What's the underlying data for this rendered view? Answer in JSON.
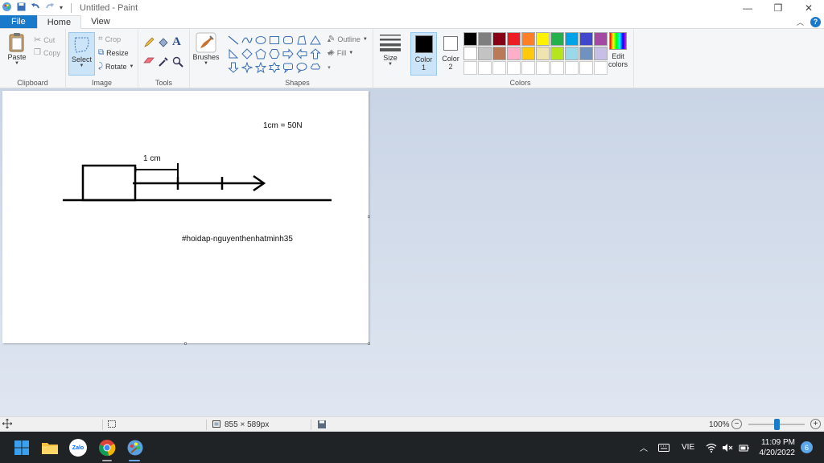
{
  "window": {
    "title": "Untitled - Paint",
    "minimize_glyph": "—",
    "restore_glyph": "❐",
    "close_glyph": "✕"
  },
  "tabs": [
    {
      "label": "File"
    },
    {
      "label": "Home"
    },
    {
      "label": "View"
    }
  ],
  "ribbon": {
    "clipboard": {
      "paste": "Paste",
      "cut": "Cut",
      "copy": "Copy",
      "group": "Clipboard"
    },
    "image": {
      "select": "Select",
      "crop": "Crop",
      "resize": "Resize",
      "rotate": "Rotate",
      "group": "Image"
    },
    "tools": {
      "group": "Tools",
      "text_glyph": "A"
    },
    "brushes": {
      "label": "Brushes"
    },
    "shapes": {
      "outline": "Outline",
      "fill": "Fill",
      "group": "Shapes"
    },
    "size": {
      "label": "Size"
    },
    "colors": {
      "color1": "Color 1",
      "color2": "Color 2",
      "edit": "Edit colors",
      "group": "Colors",
      "palette": [
        "#000000",
        "#7f7f7f",
        "#880015",
        "#ed1c24",
        "#ff7f27",
        "#fff200",
        "#22b14c",
        "#00a2e8",
        "#3f48cc",
        "#a349a4",
        "#ffffff",
        "#c3c3c3",
        "#b97a57",
        "#ffaec9",
        "#ffc90e",
        "#efe4b0",
        "#b5e61d",
        "#99d9ea",
        "#7092be",
        "#c8bfe7",
        "#ffffff",
        "#ffffff",
        "#ffffff",
        "#ffffff",
        "#ffffff",
        "#ffffff",
        "#ffffff",
        "#ffffff",
        "#ffffff",
        "#ffffff"
      ],
      "primary": "#000000",
      "secondary": "#ffffff",
      "accent": "#1979ca"
    }
  },
  "canvas": {
    "scale_text": "1cm = 50N",
    "unit_text": "1 cm",
    "hashtag_text": "#hoidap-nguyenthenhatminh35"
  },
  "status": {
    "dimensions": "855 × 589px",
    "zoom": "100%"
  },
  "taskbar": {
    "language": "VIE",
    "time": "11:09 PM",
    "date": "4/20/2022",
    "notifications": "6",
    "zalo": "Zalo"
  }
}
